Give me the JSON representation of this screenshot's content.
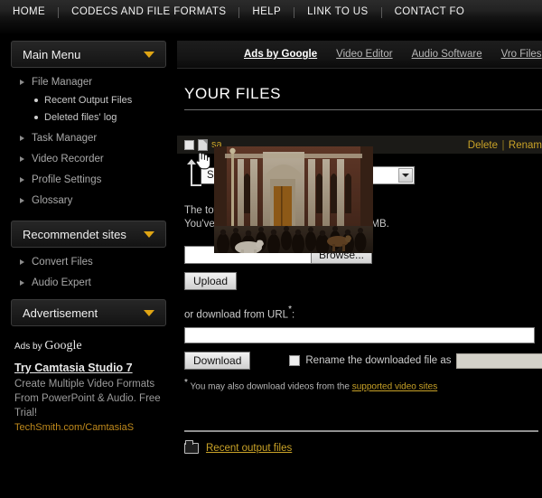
{
  "topnav": {
    "items": [
      {
        "label": "HOME"
      },
      {
        "label": "CODECS AND FILE FORMATS"
      },
      {
        "label": "HELP"
      },
      {
        "label": "LINK TO US"
      },
      {
        "label": "CONTACT FO"
      }
    ]
  },
  "sidebar": {
    "main_menu": {
      "title": "Main Menu",
      "items": [
        {
          "label": "File Manager",
          "sub": [
            {
              "label": "Recent Output Files"
            },
            {
              "label": "Deleted files' log"
            }
          ]
        },
        {
          "label": "Task Manager",
          "sub": []
        },
        {
          "label": "Video Recorder",
          "sub": []
        },
        {
          "label": "Profile Settings",
          "sub": []
        },
        {
          "label": "Glossary",
          "sub": []
        }
      ]
    },
    "recommended": {
      "title": "Recommendet sites",
      "items": [
        {
          "label": "Convert Files"
        },
        {
          "label": "Audio Expert"
        }
      ]
    },
    "advertisement": {
      "title": "Advertisement",
      "ads_by_prefix": "Ads by",
      "ads_by_brand": "Google",
      "ad_title": "Try Camtasia Studio 7",
      "ad_body": "Create Multiple Video Formats From PowerPoint & Audio. Free Trial!",
      "ad_url": "TechSmith.com/CamtasiaS"
    }
  },
  "main": {
    "ads_bar": [
      {
        "label": "Ads by Google",
        "strong": true
      },
      {
        "label": "Video Editor",
        "strong": false
      },
      {
        "label": "Audio Software",
        "strong": false
      },
      {
        "label": "Vro Files",
        "strong": false
      }
    ],
    "page_title": "YOUR FILES",
    "file_row": {
      "file_name": "sa",
      "delete_label": "Delete",
      "separator": "|",
      "rename_label": "Renam"
    },
    "toolbar": {
      "select_label": "Sel",
      "dropdown_value": ""
    },
    "quota": {
      "line1": "The total ... n (Standard) is 300 MB.",
      "line2": "You've us ... available for upload 286.41 MB."
    },
    "upload": {
      "file_value": "",
      "browse_label": "Browse...",
      "upload_label": "Upload"
    },
    "url_download": {
      "label": "or download from URL",
      "star": "*",
      "colon": ":",
      "url_value": "",
      "download_label": "Download",
      "rename_checkbox_label": "Rename the downloaded file as",
      "rename_value": ""
    },
    "note": {
      "star": "*",
      "text": "You may also download videos from the",
      "link": "supported video sites"
    },
    "recent_output": {
      "label": "Recent output files"
    }
  },
  "colors": {
    "accent_gold": "#c9a227",
    "chevron_gold": "#e0a514",
    "page_bg": "#000000",
    "nav_bg": "#232323"
  }
}
